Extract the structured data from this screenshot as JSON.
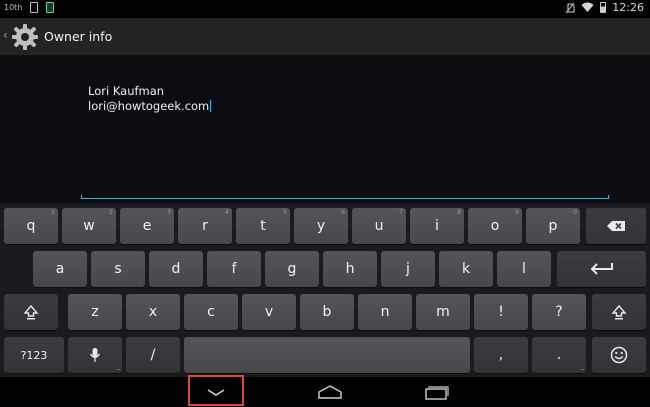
{
  "status_bar": {
    "left_text": "10th",
    "time": "12:26",
    "icons": [
      "screenshot-icon",
      "shield-app-icon",
      "no-sim-icon",
      "wifi-icon",
      "battery-icon"
    ]
  },
  "action_bar": {
    "title": "Owner info",
    "icon": "settings-gear-icon",
    "back_glyph": "‹"
  },
  "owner_info": {
    "line1": "Lori Kaufman",
    "line2": "lori@howtogeek.com"
  },
  "keyboard": {
    "row1": [
      {
        "k": "q",
        "n": "1"
      },
      {
        "k": "w",
        "n": "2"
      },
      {
        "k": "e",
        "n": "3"
      },
      {
        "k": "r",
        "n": "4"
      },
      {
        "k": "t",
        "n": "5"
      },
      {
        "k": "y",
        "n": "6"
      },
      {
        "k": "u",
        "n": "7"
      },
      {
        "k": "i",
        "n": "8"
      },
      {
        "k": "o",
        "n": "9"
      },
      {
        "k": "p",
        "n": "0"
      }
    ],
    "row2": [
      "a",
      "s",
      "d",
      "f",
      "g",
      "h",
      "j",
      "k",
      "l"
    ],
    "row3": [
      "z",
      "x",
      "c",
      "v",
      "b",
      "n",
      "m",
      "!",
      "?"
    ],
    "symbols_label": "?123",
    "slash": "/",
    "comma": ",",
    "period": ".",
    "row3_hints": [
      "",
      "",
      "",
      "",
      "",
      "",
      "",
      "",
      ""
    ],
    "more_hint": "..."
  },
  "nav_bar": {
    "icons": [
      "hide-keyboard-icon",
      "home-icon",
      "recent-apps-icon"
    ]
  },
  "colors": {
    "accent": "#33b5e5",
    "highlight": "#e0473c"
  }
}
